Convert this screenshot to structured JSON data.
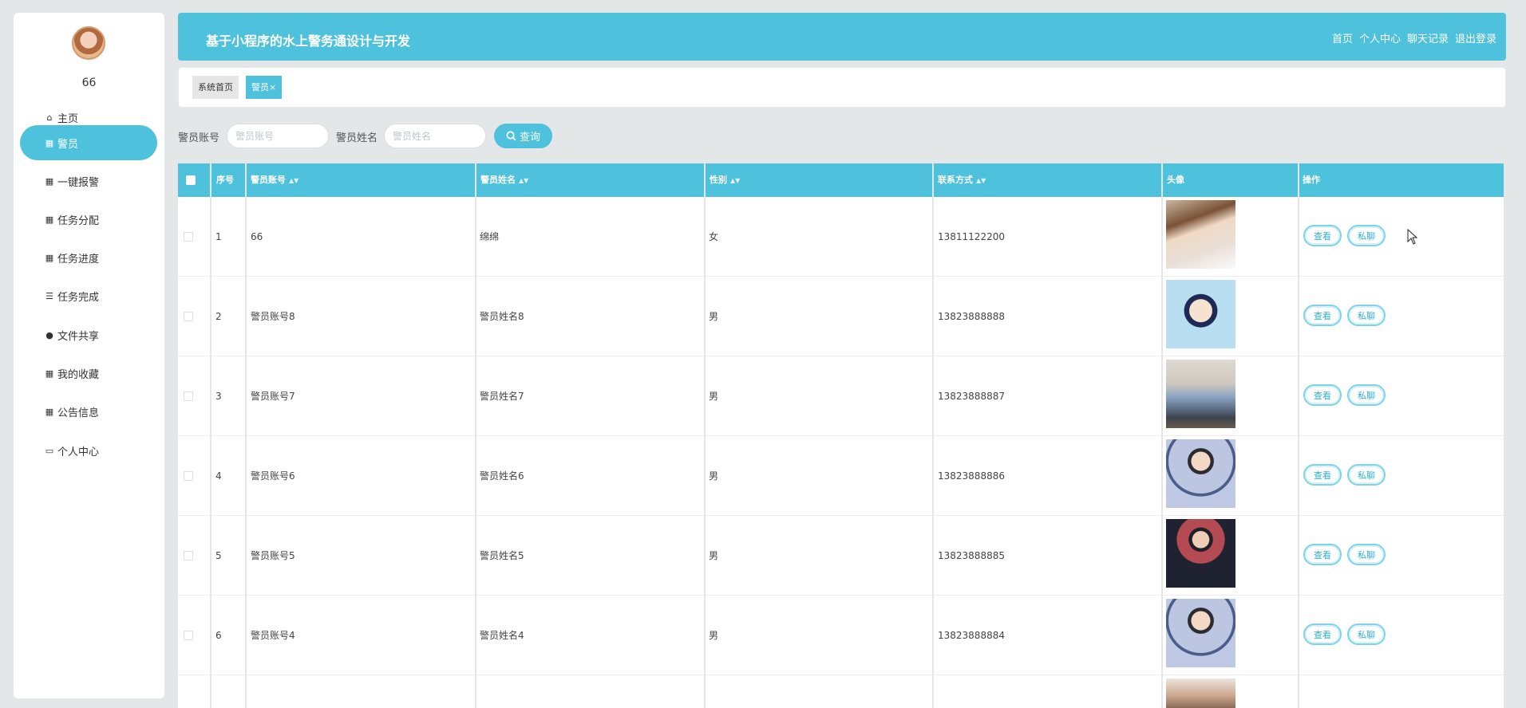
{
  "sidebar": {
    "username": "66",
    "items": [
      {
        "label": "主页",
        "icon": "home-icon",
        "glyph": "⌂"
      },
      {
        "label": "警员",
        "icon": "grid-icon",
        "glyph": "▦"
      },
      {
        "label": "一键报警",
        "icon": "grid-icon",
        "glyph": "▦"
      },
      {
        "label": "任务分配",
        "icon": "grid-icon",
        "glyph": "▦"
      },
      {
        "label": "任务进度",
        "icon": "grid-icon",
        "glyph": "▦"
      },
      {
        "label": "任务完成",
        "icon": "list-icon",
        "glyph": "☰"
      },
      {
        "label": "文件共享",
        "icon": "pin-icon",
        "glyph": "●"
      },
      {
        "label": "我的收藏",
        "icon": "grid-icon",
        "glyph": "▦"
      },
      {
        "label": "公告信息",
        "icon": "grid-icon",
        "glyph": "▦"
      },
      {
        "label": "个人中心",
        "icon": "wallet-icon",
        "glyph": "▭"
      }
    ]
  },
  "header": {
    "title": "基于小程序的水上警务通设计与开发",
    "nav": [
      "首页",
      "个人中心",
      "聊天记录",
      "退出登录"
    ]
  },
  "tabs": {
    "home": "系统首页",
    "current": "警员",
    "close": "×"
  },
  "search": {
    "account_label": "警员账号",
    "account_placeholder": "警员账号",
    "name_label": "警员姓名",
    "name_placeholder": "警员姓名",
    "button": "查询"
  },
  "table": {
    "headers": [
      "序号",
      "警员账号",
      "警员姓名",
      "性别",
      "联系方式",
      "头像",
      "操作"
    ],
    "rows": [
      {
        "no": "1",
        "account": "66",
        "name": "绵绵",
        "gender": "女",
        "phone": "13811122200"
      },
      {
        "no": "2",
        "account": "警员账号8",
        "name": "警员姓名8",
        "gender": "男",
        "phone": "13823888888"
      },
      {
        "no": "3",
        "account": "警员账号7",
        "name": "警员姓名7",
        "gender": "男",
        "phone": "13823888887"
      },
      {
        "no": "4",
        "account": "警员账号6",
        "name": "警员姓名6",
        "gender": "男",
        "phone": "13823888886"
      },
      {
        "no": "5",
        "account": "警员账号5",
        "name": "警员姓名5",
        "gender": "男",
        "phone": "13823888885"
      },
      {
        "no": "6",
        "account": "警员账号4",
        "name": "警员姓名4",
        "gender": "男",
        "phone": "13823888884"
      }
    ],
    "view_label": "查看",
    "chat_label": "私聊"
  },
  "colors": {
    "accent": "#4ec1dc",
    "background": "#e3e7e8"
  }
}
